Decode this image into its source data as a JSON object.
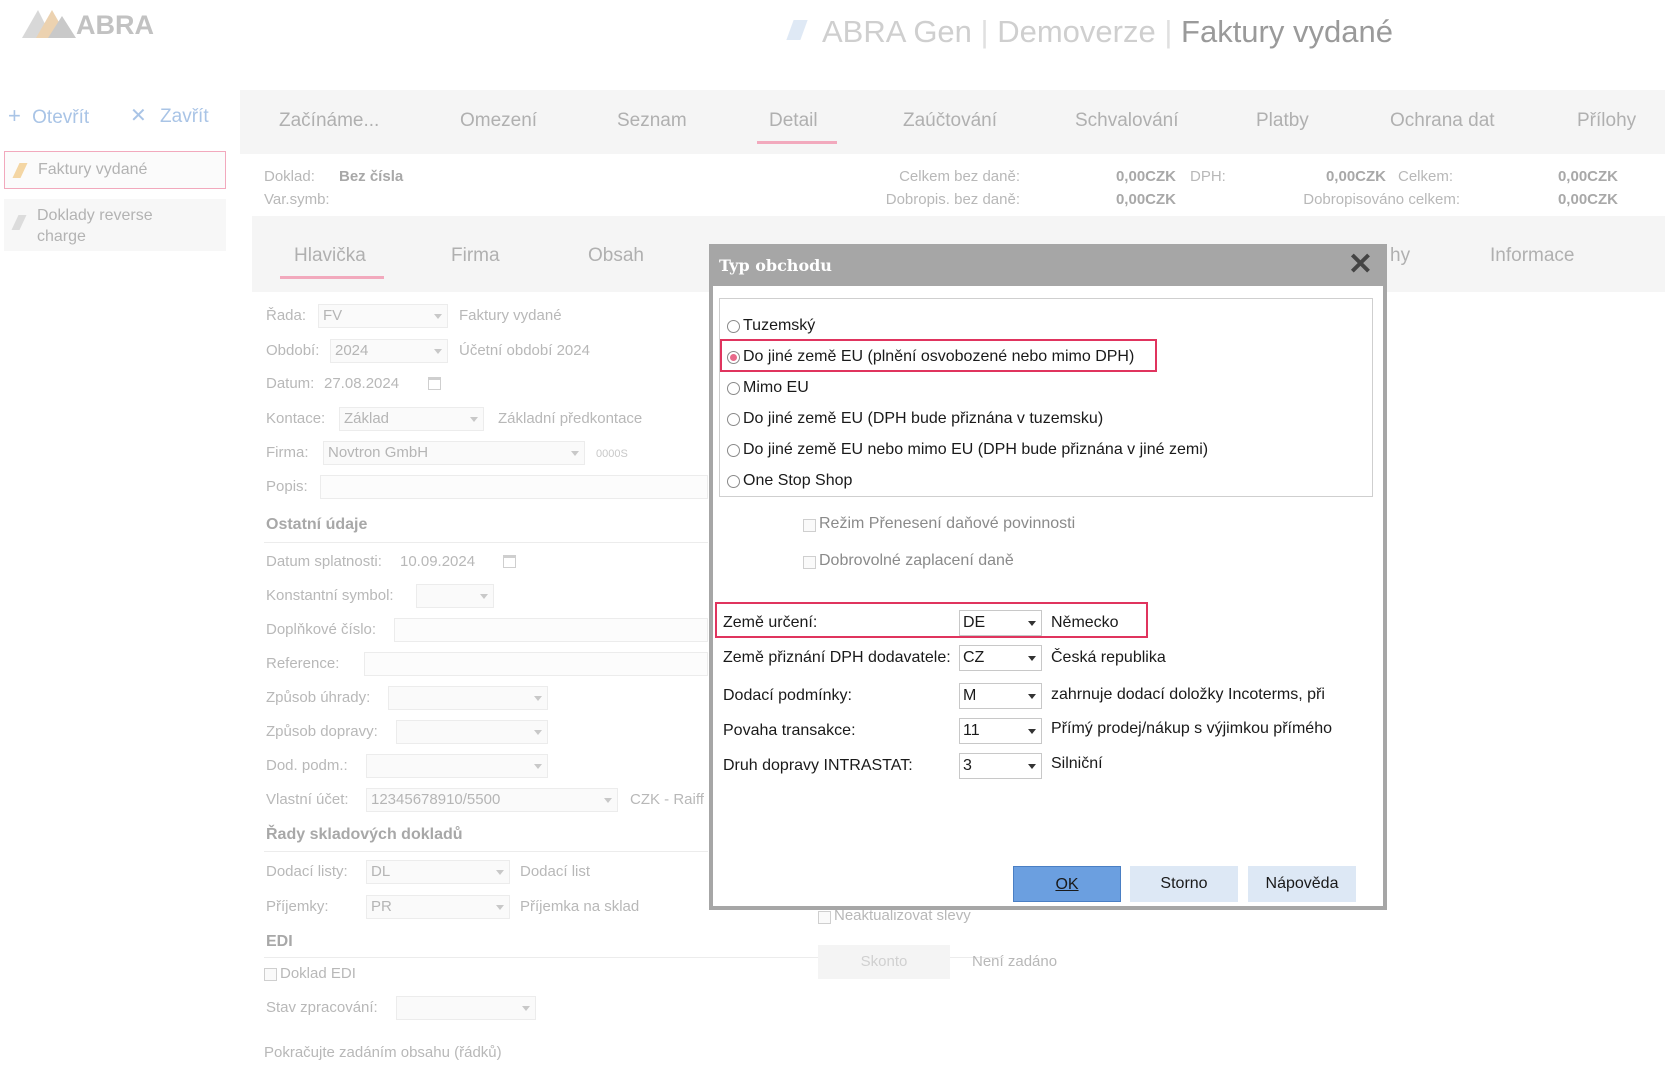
{
  "app": {
    "logo_text": "ABRA",
    "title_app": "ABRA Gen",
    "title_mode": "Demoverze",
    "title_agenda": "Faktury vydané"
  },
  "sidebar": {
    "open_label": "Otevřít",
    "close_label": "Zavřít",
    "items": [
      {
        "label": "Faktury vydané"
      },
      {
        "label": "Doklady reverse charge"
      }
    ]
  },
  "main_tabs": [
    "Začínáme...",
    "Omezení",
    "Seznam",
    "Detail",
    "Zaúčtování",
    "Schvalování",
    "Platby",
    "Ochrana dat",
    "Přílohy"
  ],
  "summary": {
    "doklad_label": "Doklad:",
    "doklad_value": "Bez čísla",
    "varsymb_label": "Var.symb:",
    "celkem_bez_dane_label": "Celkem bez daně:",
    "celkem_bez_dane_value": "0,00CZK",
    "dph_label": "DPH:",
    "dph_value": "0,00CZK",
    "celkem_label": "Celkem:",
    "celkem_value": "0,00CZK",
    "dobropis_bez_dane_label": "Dobropis. bez daně:",
    "dobropis_bez_dane_value": "0,00CZK",
    "dobropisovano_label": "Dobropisováno celkem:",
    "dobropisovano_value": "0,00CZK"
  },
  "sub_tabs": [
    "Hlavička",
    "Firma",
    "Obsah",
    "hy",
    "Informace"
  ],
  "form": {
    "rada_label": "Řada:",
    "rada_value": "FV",
    "rada_desc": "Faktury vydané",
    "obdobi_label": "Období:",
    "obdobi_value": "2024",
    "obdobi_desc": "Účetní období 2024",
    "datum_label": "Datum:",
    "datum_value": "27.08.2024",
    "kontace_label": "Kontace:",
    "kontace_value": "Základ",
    "kontace_desc": "Základní předkontace",
    "firma_label": "Firma:",
    "firma_value": "Novtron GmbH",
    "firma_code": "0000S",
    "popis_label": "Popis:",
    "ostatni_title": "Ostatní údaje",
    "splatnost_label": "Datum splatnosti:",
    "splatnost_value": "10.09.2024",
    "konst_symbol_label": "Konstantní symbol:",
    "dopl_cislo_label": "Doplňkové číslo:",
    "reference_label": "Reference:",
    "zpusob_uhrady_label": "Způsob úhrady:",
    "zpusob_dopravy_label": "Způsob dopravy:",
    "dod_podm_label": "Dod. podm.:",
    "vlastni_ucet_label": "Vlastní účet:",
    "vlastni_ucet_value": "12345678910/5500",
    "vlastni_ucet_desc": "CZK - Raiff",
    "rady_title": "Řady skladových dokladů",
    "dodaci_listy_label": "Dodací listy:",
    "dodaci_listy_value": "DL",
    "dodaci_listy_desc": "Dodací list",
    "prijemky_label": "Příjemky:",
    "prijemky_value": "PR",
    "prijemky_desc": "Příjemka na sklad",
    "edi_title": "EDI",
    "doklad_edi_label": "Doklad EDI",
    "stav_label": "Stav zpracování:",
    "pokracujte": "Pokračujte zadáním obsahu (řádků)",
    "neaktualizovat": "Neaktualizovat slevy",
    "skonto_label": "Skonto",
    "neni_zadano": "Není zadáno"
  },
  "dialog": {
    "title": "Typ obchodu",
    "radios": [
      {
        "label": "Tuzemský",
        "selected": false
      },
      {
        "label": "Do jiné země EU (plnění osvobozené nebo mimo DPH)",
        "selected": true
      },
      {
        "label": "Mimo EU",
        "selected": false
      },
      {
        "label": "Do jiné země EU (DPH bude přiznána v tuzemsku)",
        "selected": false
      },
      {
        "label": "Do jiné země EU nebo mimo EU (DPH bude přiznána v jiné zemi)",
        "selected": false
      },
      {
        "label": "One Stop Shop",
        "selected": false
      }
    ],
    "rezim_label": "Režim Přenesení daňové povinnosti",
    "dobrovolne_label": "Dobrovolné zaplacení daně",
    "rows": [
      {
        "label": "Země určení:",
        "value": "DE",
        "desc": "Německo"
      },
      {
        "label": "Země přiznání DPH dodavatele:",
        "value": "CZ",
        "desc": "Česká republika"
      },
      {
        "label": "Dodací podmínky:",
        "value": "M",
        "desc": "zahrnuje dodací doložky Incoterms, při"
      },
      {
        "label": "Povaha transakce:",
        "value": "11",
        "desc": "Přímý prodej/nákup s výjimkou přímého"
      },
      {
        "label": "Druh dopravy INTRASTAT:",
        "value": "3",
        "desc": "Silniční"
      }
    ],
    "ok_label": "OK",
    "storno_label": "Storno",
    "napoveda_label": "Nápověda"
  },
  "colors": {
    "accent": "#e0345e",
    "ok_button": "#6b9fe0",
    "button": "#dde8f5",
    "dialog_border": "#a6a6a6"
  }
}
